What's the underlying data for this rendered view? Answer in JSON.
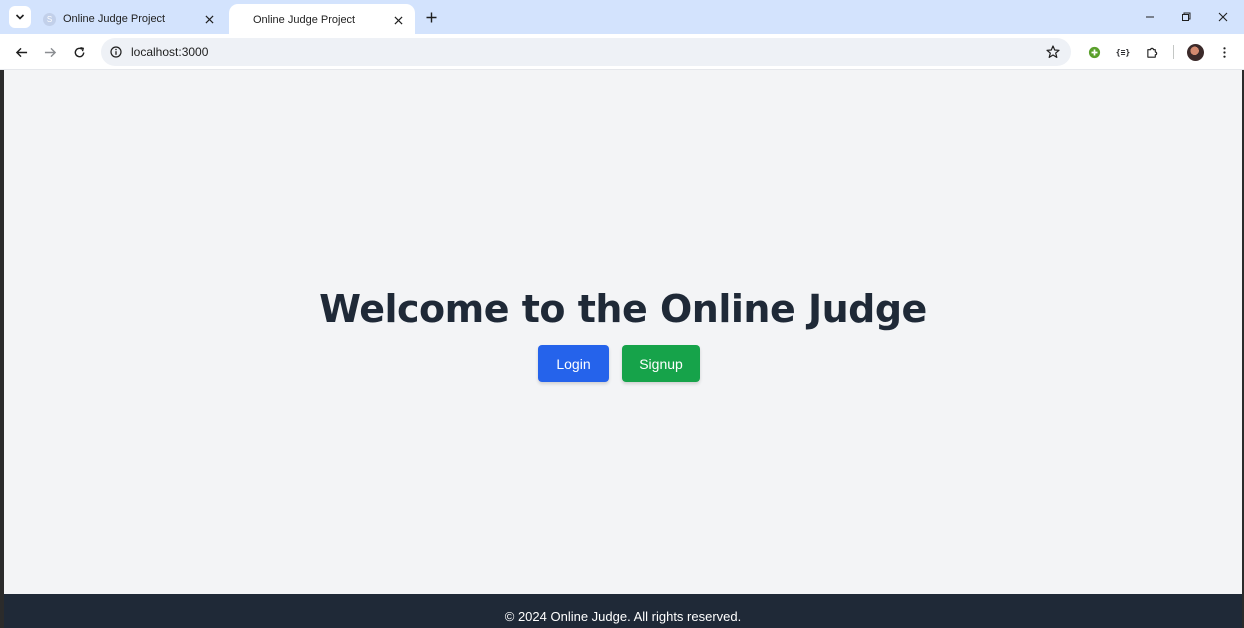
{
  "browser": {
    "tabs": [
      {
        "title": "Online Judge Project",
        "favicon_letter": "S",
        "active": false
      },
      {
        "title": "Online Judge Project",
        "active": true
      }
    ],
    "url": "localhost:3000",
    "ext2_label": "{≡}"
  },
  "main": {
    "heading": "Welcome to the Online Judge",
    "login_label": "Login",
    "signup_label": "Signup"
  },
  "footer": {
    "text": "© 2024 Online Judge. All rights reserved."
  },
  "colors": {
    "login_button": "#2563eb",
    "signup_button": "#16a34a",
    "footer_background": "#1f2937",
    "page_background": "#f3f4f6",
    "heading_text": "#1f2937"
  }
}
